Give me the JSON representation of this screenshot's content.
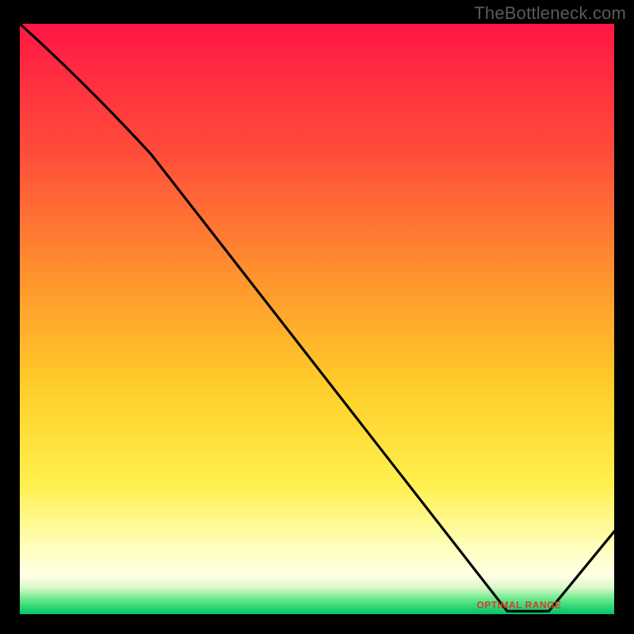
{
  "attribution": "TheBottleneck.com",
  "colors": {
    "bg": "#000000",
    "attribution": "#5a5a5a",
    "curve": "#000000",
    "optimal_label": "#d93a2b",
    "gradient_stops": [
      {
        "offset": 0,
        "color": "#ff1744"
      },
      {
        "offset": 0.22,
        "color": "#ff4d3a"
      },
      {
        "offset": 0.45,
        "color": "#ff9a2c"
      },
      {
        "offset": 0.62,
        "color": "#ffcf2a"
      },
      {
        "offset": 0.78,
        "color": "#fff04d"
      },
      {
        "offset": 0.89,
        "color": "#ffffc0"
      },
      {
        "offset": 0.935,
        "color": "#ffffe6"
      },
      {
        "offset": 0.955,
        "color": "#d8f8c8"
      },
      {
        "offset": 0.975,
        "color": "#66e88a"
      },
      {
        "offset": 1.0,
        "color": "#00c466"
      }
    ]
  },
  "chart_data": {
    "type": "line",
    "title": "",
    "xlabel": "",
    "ylabel": "",
    "xlim": [
      0,
      100
    ],
    "ylim": [
      0,
      100
    ],
    "grid": false,
    "legend": false,
    "x": [
      0,
      22,
      82,
      89,
      100
    ],
    "values": [
      100,
      78,
      0.5,
      0.5,
      14
    ],
    "optimal_range_x": [
      76,
      92
    ],
    "optimal_y": 0.5,
    "note": "Line starts upper-left, gentle slope to x≈22, steep linear drop to the green band near x≈82, flat minimum along green band, then rises to the right edge."
  },
  "optimal_label_text": "OPTIMAL RANGE"
}
